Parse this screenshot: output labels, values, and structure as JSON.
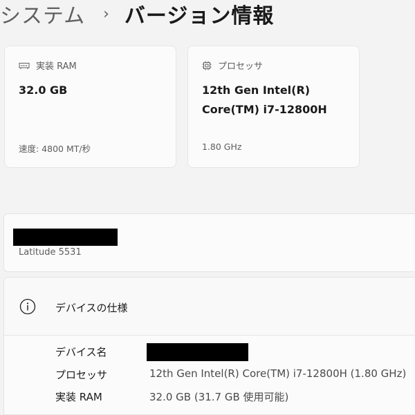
{
  "breadcrumb": {
    "parent": "システム",
    "separator": "›",
    "current": "バージョン情報"
  },
  "cards": [
    {
      "icon": "ram-icon",
      "label": "実装 RAM",
      "value_line1": "32.0 GB",
      "value_line2": "",
      "sub": "速度: 4800 MT/秒"
    },
    {
      "icon": "processor-icon",
      "label": "プロセッサ",
      "value_line1": "12th Gen Intel(R)",
      "value_line2": "Core(TM) i7-12800H",
      "sub": "1.80 GHz"
    }
  ],
  "device": {
    "model": "Latitude 5531"
  },
  "specs": {
    "title": "デバイスの仕様",
    "rows": [
      {
        "label": "デバイス名",
        "value": ""
      },
      {
        "label": "プロセッサ",
        "value": "12th Gen Intel(R) Core(TM) i7-12800H (1.80 GHz)"
      },
      {
        "label": "実装 RAM",
        "value": "32.0 GB (31.7 GB 使用可能)"
      }
    ]
  },
  "colors": {
    "background": "#f3f3f3",
    "card": "#fbfbfb",
    "redaction": "#000000"
  }
}
